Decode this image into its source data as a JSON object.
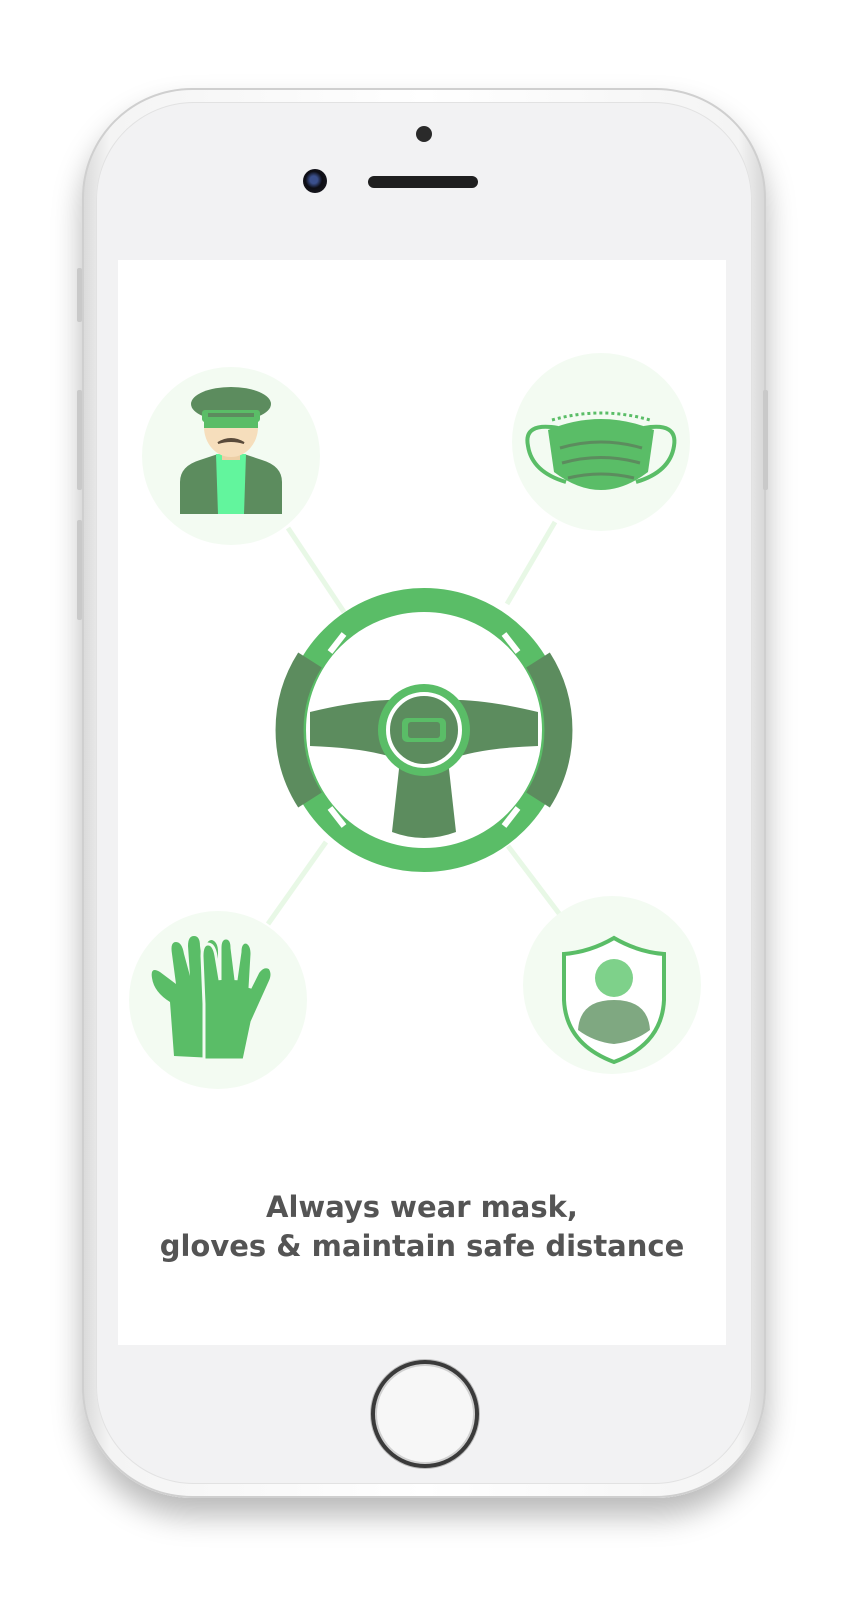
{
  "caption": {
    "line1": "Always wear mask,",
    "line2": "gloves & maintain safe distance"
  },
  "icons": [
    "driver-icon",
    "face-mask-icon",
    "steering-wheel-icon",
    "gloves-icon",
    "shield-user-icon"
  ],
  "colors": {
    "light_green": "#5ABD67",
    "dark_green": "#5C8C5E",
    "bright_green": "#62F59D",
    "circle_bg": "#F3FBF2",
    "connector": "#E8F8E6",
    "text": "#545454"
  }
}
